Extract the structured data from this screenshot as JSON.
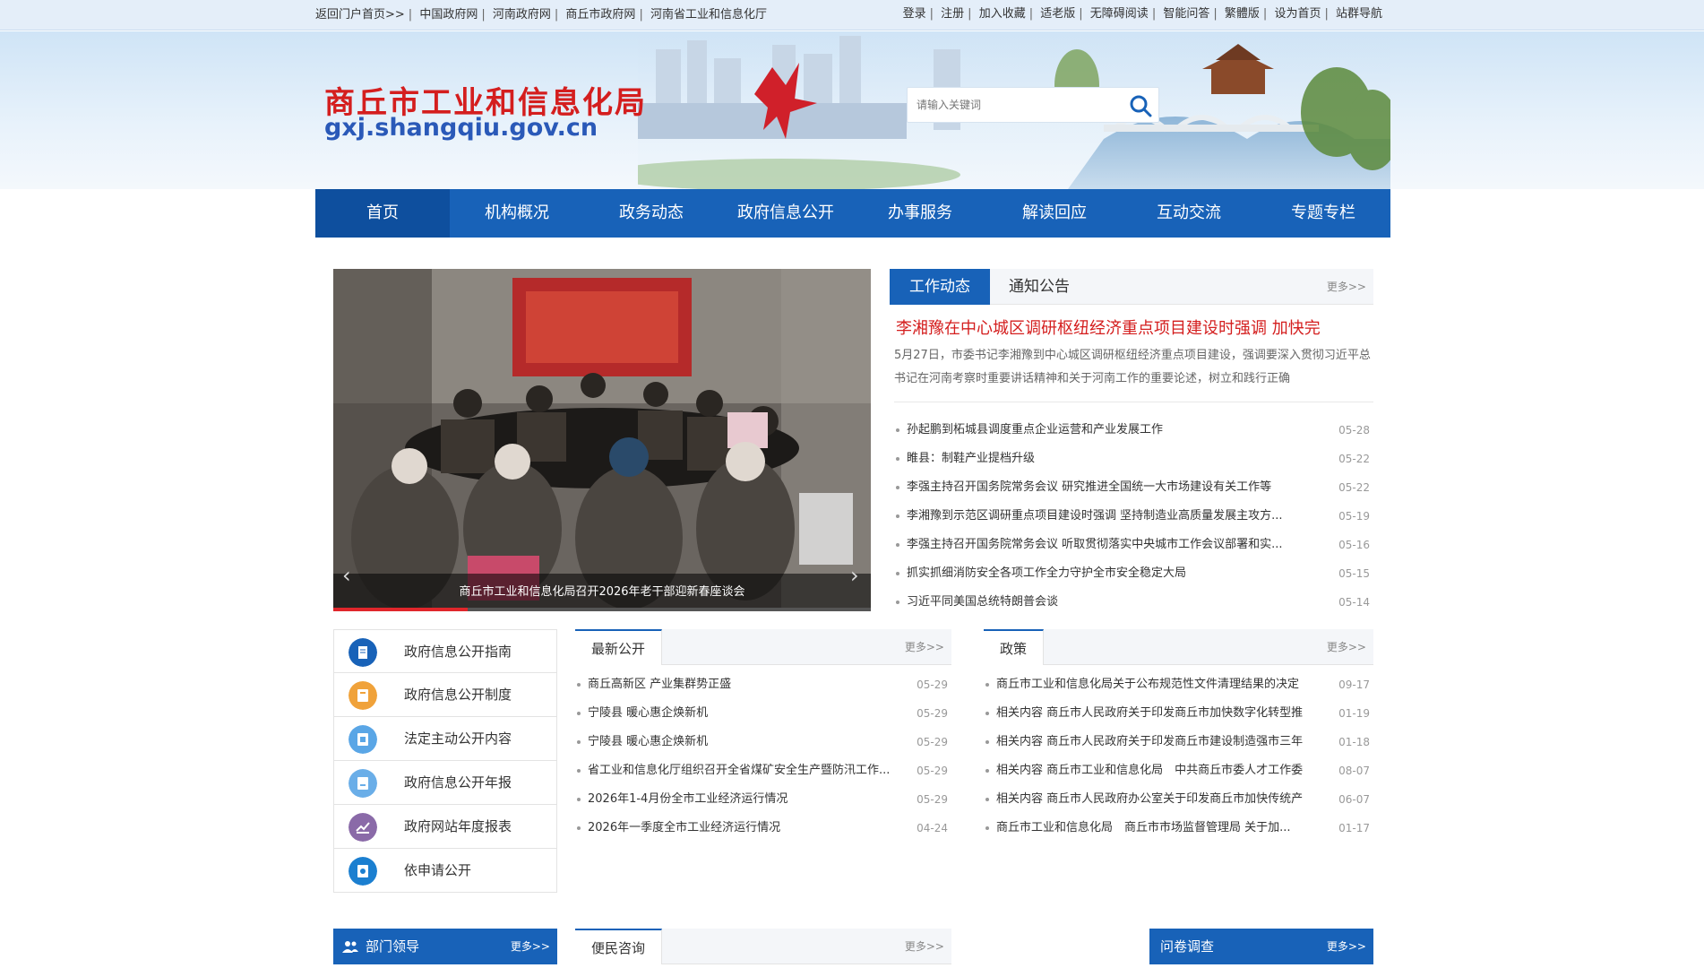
{
  "topbar": {
    "left_links": [
      "返回门户首页>>",
      "中国政府网",
      "河南政府网",
      "商丘市政府网",
      "河南省工业和信息化厅"
    ],
    "right_links": [
      "登录",
      "注册",
      "加入收藏",
      "适老版",
      "无障碍阅读",
      "智能问答",
      "繁體版",
      "设为首页",
      "站群导航"
    ]
  },
  "banner": {
    "logo_cn": "商丘市工业和信息化局",
    "logo_en": "gxj.shangqiu.gov.cn",
    "search_placeholder": "请输入关键词"
  },
  "nav": [
    "首页",
    "机构概况",
    "政务动态",
    "政府信息公开",
    "办事服务",
    "解读回应",
    "互动交流",
    "专题专栏"
  ],
  "slider": {
    "caption": "商丘市工业和信息化局召开2026年老干部迎新春座谈会"
  },
  "news": {
    "tabs": [
      "工作动态",
      "通知公告"
    ],
    "more": "更多>>",
    "headline": "李湘豫在中心城区调研枢纽经济重点项目建设时强调 加快完",
    "summary": "5月27日，市委书记李湘豫到中心城区调研枢纽经济重点项目建设，强调要深入贯彻习近平总书记在河南考察时重要讲话精神和关于河南工作的重要论述，树立和践行正确",
    "items": [
      {
        "title": "孙起鹏到柘城县调度重点企业运营和产业发展工作",
        "date": "05-28"
      },
      {
        "title": "睢县：制鞋产业提档升级",
        "date": "05-22"
      },
      {
        "title": "李强主持召开国务院常务会议 研究推进全国统一大市场建设有关工作等",
        "date": "05-22"
      },
      {
        "title": "李湘豫到示范区调研重点项目建设时强调 坚持制造业高质量发展主攻方...",
        "date": "05-19"
      },
      {
        "title": "李强主持召开国务院常务会议 听取贯彻落实中央城市工作会议部署和实...",
        "date": "05-16"
      },
      {
        "title": "抓实抓细消防安全各项工作全力守护全市安全稳定大局",
        "date": "05-15"
      },
      {
        "title": "习近平同美国总统特朗普会谈",
        "date": "05-14"
      }
    ]
  },
  "sidebar": {
    "items": [
      {
        "label": "政府信息公开指南",
        "color": "#1862b8"
      },
      {
        "label": "政府信息公开制度",
        "color": "#f0a23a"
      },
      {
        "label": "法定主动公开内容",
        "color": "#5aa6e6"
      },
      {
        "label": "政府信息公开年报",
        "color": "#6aaee8"
      },
      {
        "label": "政府网站年度报表",
        "color": "#8a6aa8"
      },
      {
        "label": "依申请公开",
        "color": "#1b7fd0"
      }
    ]
  },
  "latest": {
    "title": "最新公开",
    "more": "更多>>",
    "items": [
      {
        "title": "商丘高新区 产业集群势正盛",
        "date": "05-29"
      },
      {
        "title": "宁陵县 暖心惠企焕新机",
        "date": "05-29"
      },
      {
        "title": "宁陵县 暖心惠企焕新机",
        "date": "05-29"
      },
      {
        "title": "省工业和信息化厅组织召开全省煤矿安全生产暨防汛工作...",
        "date": "05-29"
      },
      {
        "title": "2026年1-4月份全市工业经济运行情况",
        "date": "05-29"
      },
      {
        "title": "2026年一季度全市工业经济运行情况",
        "date": "04-24"
      }
    ]
  },
  "policy": {
    "title": "政策",
    "more": "更多>>",
    "items": [
      {
        "title": "商丘市工业和信息化局关于公布规范性文件清理结果的决定",
        "date": "09-17"
      },
      {
        "title": "相关内容 商丘市人民政府关于印发商丘市加快数字化转型推",
        "date": "01-19"
      },
      {
        "title": "相关内容 商丘市人民政府关于印发商丘市建设制造强市三年",
        "date": "01-18"
      },
      {
        "title": "相关内容 商丘市工业和信息化局　中共商丘市委人才工作委",
        "date": "08-07"
      },
      {
        "title": "相关内容 商丘市人民政府办公室关于印发商丘市加快传统产",
        "date": "06-07"
      },
      {
        "title": "商丘市工业和信息化局　商丘市市场监督管理局 关于加...",
        "date": "01-17"
      }
    ]
  },
  "bottom": {
    "leaders": "部门领导",
    "consult": "便民咨询",
    "survey": "问卷调查",
    "more": "更多>>"
  }
}
